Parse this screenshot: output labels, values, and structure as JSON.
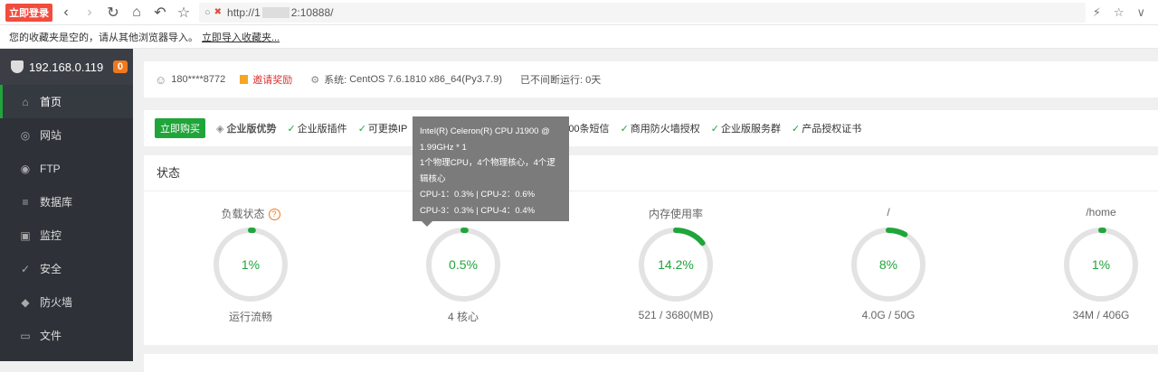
{
  "browser": {
    "login_badge": "立即登录",
    "url_prefix": "http://1",
    "url_suffix": "2:10888/",
    "icons": [
      "back-icon",
      "forward-icon",
      "refresh-icon",
      "home-icon",
      "undo-icon",
      "star-icon"
    ]
  },
  "bookmark_bar": {
    "message": "您的收藏夹是空的，请从其他浏览器导入。",
    "import_link": "立即导入收藏夹..."
  },
  "sidebar": {
    "server_ip": "192.168.0.119",
    "count_badge": "0",
    "items": [
      {
        "label": "首页",
        "icon": "home-icon",
        "active": true
      },
      {
        "label": "网站",
        "icon": "globe-icon"
      },
      {
        "label": "FTP",
        "icon": "ftp-icon"
      },
      {
        "label": "数据库",
        "icon": "database-icon"
      },
      {
        "label": "监控",
        "icon": "monitor-icon"
      },
      {
        "label": "安全",
        "icon": "security-icon"
      },
      {
        "label": "防火墙",
        "icon": "firewall-icon"
      },
      {
        "label": "文件",
        "icon": "folder-icon"
      }
    ]
  },
  "userbar": {
    "phone": "180****8772",
    "invite": "邀请奖励",
    "system_label": "系统:",
    "system_value": "CentOS 7.6.1810 x86_64(Py3.7.9)",
    "uptime": "已不间断运行: 0天"
  },
  "promo": {
    "buy_label": "立即购买",
    "title": "企业版优势",
    "items": [
      "企业版插件",
      "可更换IP",
      "00条短信",
      "商用防火墙授权",
      "企业版服务群",
      "产品授权证书"
    ]
  },
  "status": {
    "title": "状态",
    "gauges": [
      {
        "label": "负载状态",
        "value_text": "1%",
        "value": 1,
        "sub": "运行流畅",
        "help": "?"
      },
      {
        "label": "",
        "value_text": "0.5%",
        "value": 0.5,
        "sub": "4 核心"
      },
      {
        "label": "内存使用率",
        "value_text": "14.2%",
        "value": 14.2,
        "sub": "521 / 3680(MB)"
      },
      {
        "label": "/",
        "value_text": "8%",
        "value": 8,
        "sub": "4.0G / 50G"
      },
      {
        "label": "/home",
        "value_text": "1%",
        "value": 1,
        "sub": "34M / 406G"
      }
    ]
  },
  "tooltip": {
    "line1": "Intel(R) Celeron(R) CPU J1900 @",
    "line2": "1.99GHz * 1",
    "line3": "1个物理CPU，4个物理核心，4个逻",
    "line4": "辑核心",
    "line5": "CPU-1：0.3% | CPU-2：0.6%",
    "line6": "CPU-3：0.3% | CPU-4：0.4%"
  },
  "colors": {
    "accent": "#20a53a",
    "sidebar_bg": "#2e3238",
    "track": "#e3e3e3",
    "badge": "#f0781e"
  }
}
